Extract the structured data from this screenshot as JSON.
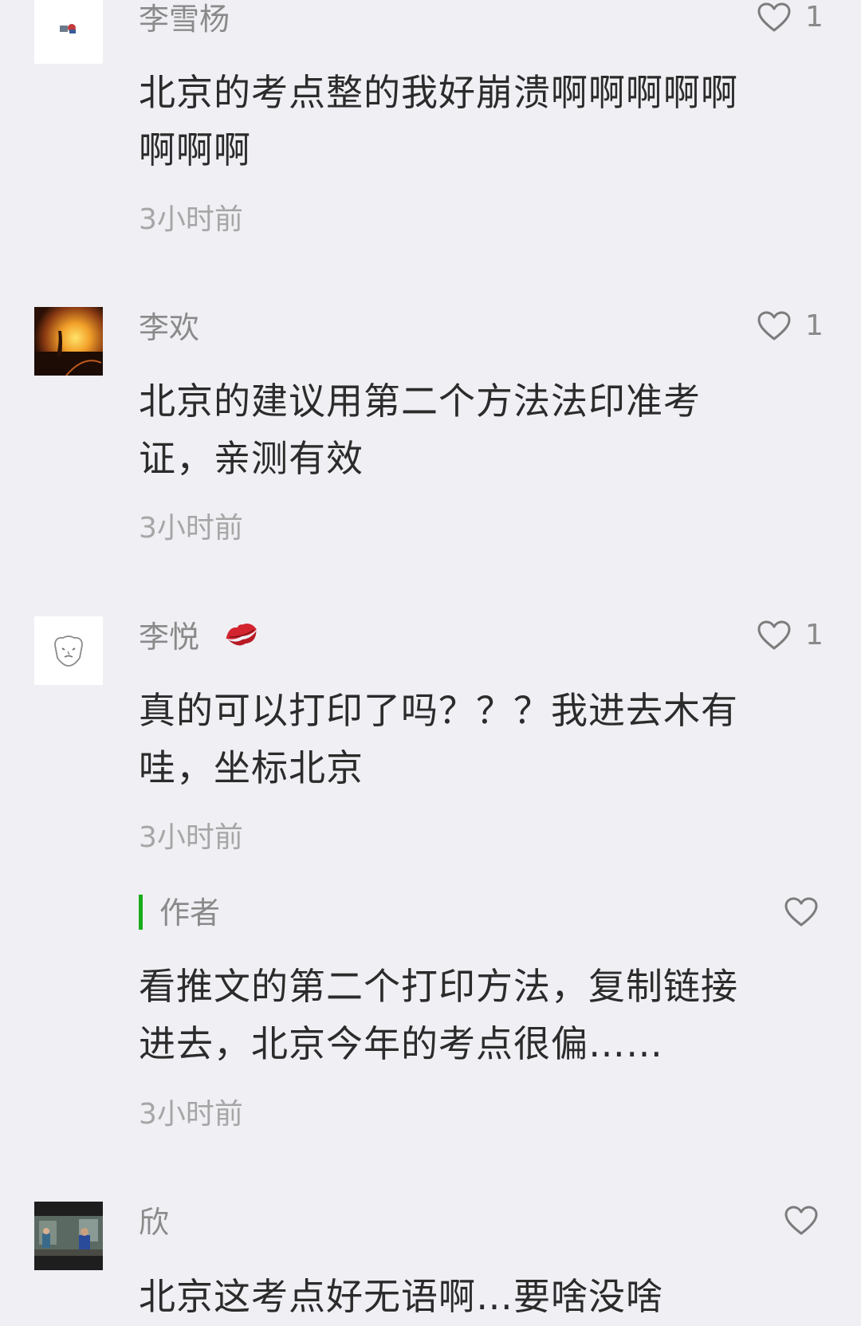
{
  "comments": [
    {
      "author": "李雪杨",
      "likes": "1",
      "text": "北京的考点整的我好崩溃啊啊啊啊啊\n啊啊啊",
      "time": "3小时前",
      "avatar_icon": "avatar-sticker-icon"
    },
    {
      "author": "李欢",
      "likes": "1",
      "text": "北京的建议用第二个方法法印准考\n证，亲测有效",
      "time": "3小时前",
      "avatar_icon": "avatar-sunset-photo"
    },
    {
      "author": "李悦",
      "author_emoji": "💋",
      "likes": "1",
      "text": "真的可以打印了吗？？？我进去木有\n哇，坐标北京",
      "time": "3小时前",
      "avatar_icon": "avatar-cartoon-face",
      "reply": {
        "author": "作者",
        "text": "看推文的第二个打印方法，复制链接\n进去，北京今年的考点很偏……",
        "time": "3小时前"
      }
    },
    {
      "author": "欣",
      "text": "北京这考点好无语啊…要啥没啥",
      "avatar_icon": "avatar-street-photo"
    }
  ],
  "colors": {
    "background": "#efeff4",
    "author_bar": "#1aad19",
    "kiss_emoji": "#d3232f"
  }
}
